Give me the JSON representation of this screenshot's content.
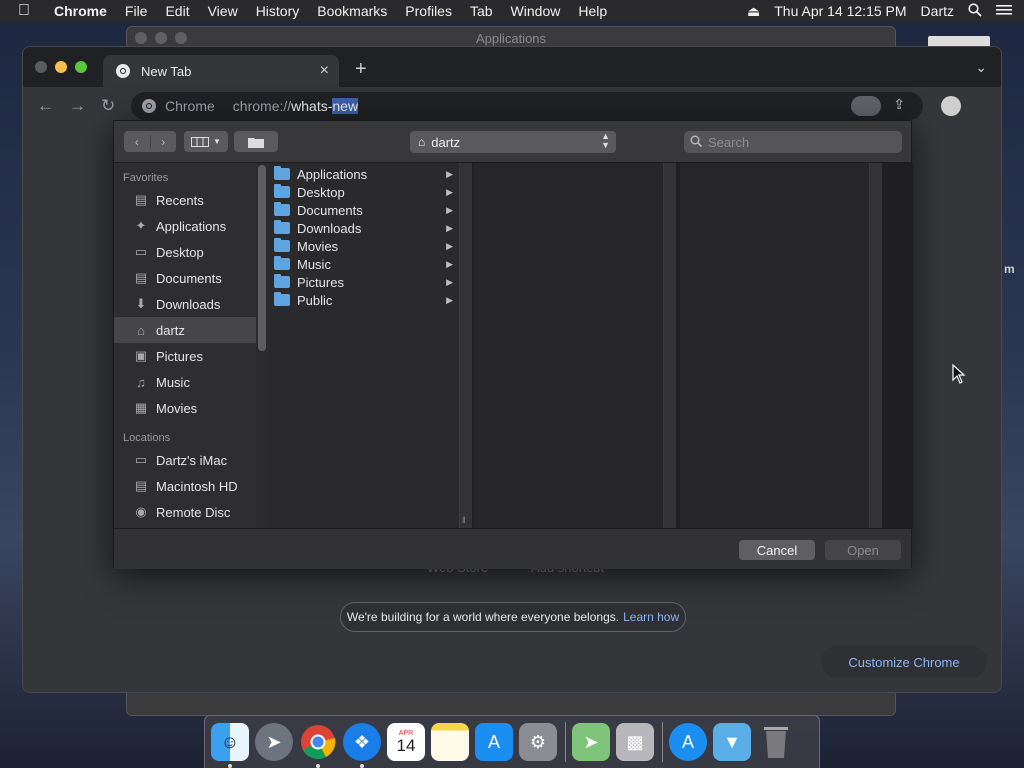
{
  "menubar": {
    "app_name": "Chrome",
    "menus": [
      "File",
      "Edit",
      "View",
      "History",
      "Bookmarks",
      "Profiles",
      "Tab",
      "Window",
      "Help"
    ],
    "clock": "Thu Apr 14  12:15 PM",
    "user": "Dartz"
  },
  "background_window": {
    "title": "Applications"
  },
  "browser": {
    "tab_title": "New Tab",
    "new_tab_symbol": "+",
    "omnibox": {
      "site_label": "Chrome",
      "url_prefix": "chrome://",
      "url_host": "whats-",
      "url_selected": "new"
    },
    "ntp_ghost_left": "Web Store",
    "ntp_ghost_right": "Add shortcut",
    "notice": {
      "text": "We're building for a world where everyone belongs.",
      "link": "Learn how"
    },
    "customize_label": "Customize Chrome"
  },
  "dialog": {
    "location": "dartz",
    "search_placeholder": "Search",
    "sidebar": {
      "favorites_header": "Favorites",
      "favorites": [
        {
          "label": "Recents",
          "icon": "recents-icon"
        },
        {
          "label": "Applications",
          "icon": "applications-icon"
        },
        {
          "label": "Desktop",
          "icon": "desktop-icon"
        },
        {
          "label": "Documents",
          "icon": "documents-icon"
        },
        {
          "label": "Downloads",
          "icon": "downloads-icon"
        },
        {
          "label": "dartz",
          "icon": "home-icon",
          "selected": true
        },
        {
          "label": "Pictures",
          "icon": "pictures-icon"
        },
        {
          "label": "Music",
          "icon": "music-icon"
        },
        {
          "label": "Movies",
          "icon": "movies-icon"
        }
      ],
      "locations_header": "Locations",
      "locations": [
        {
          "label": "Dartz's iMac",
          "icon": "computer-icon"
        },
        {
          "label": "Macintosh HD",
          "icon": "disk-icon"
        },
        {
          "label": "Remote Disc",
          "icon": "disc-icon"
        }
      ]
    },
    "files": [
      "Applications",
      "Desktop",
      "Documents",
      "Downloads",
      "Movies",
      "Music",
      "Pictures",
      "Public"
    ],
    "cancel_label": "Cancel",
    "open_label": "Open"
  },
  "dock": {
    "apps": [
      {
        "name": "finder",
        "running": true
      },
      {
        "name": "launchpad",
        "running": false
      },
      {
        "name": "chrome",
        "running": true
      },
      {
        "name": "safari",
        "running": true
      },
      {
        "name": "calendar",
        "running": false,
        "month": "APR",
        "day": "14"
      },
      {
        "name": "notes",
        "running": false
      },
      {
        "name": "app-store",
        "running": false
      },
      {
        "name": "system-preferences",
        "running": false
      },
      {
        "name": "maps",
        "running": false
      },
      {
        "name": "installer",
        "running": false
      },
      {
        "name": "app-store-folder",
        "running": false
      },
      {
        "name": "downloads-folder",
        "running": false
      },
      {
        "name": "trash",
        "running": false
      }
    ]
  },
  "colors": {
    "accent_link": "#8ab4f8",
    "folder_blue": "#5ea4e0",
    "url_selection": "#3d5fa8"
  }
}
